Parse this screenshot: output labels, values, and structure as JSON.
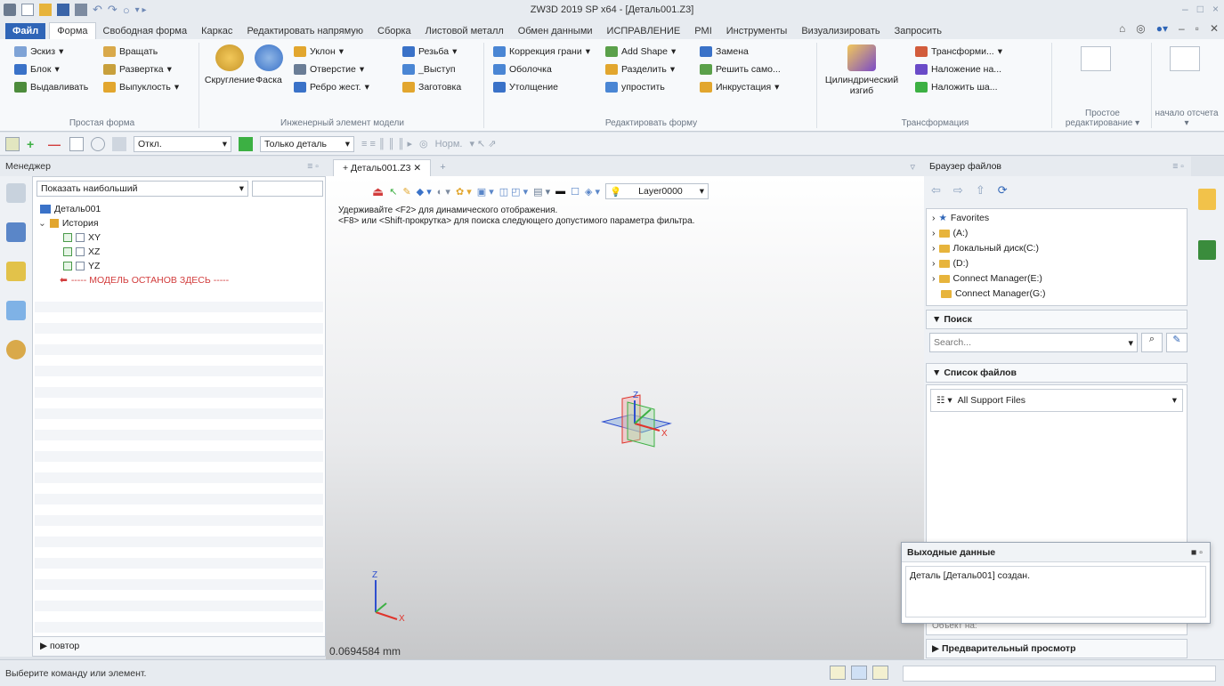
{
  "window": {
    "title": "ZW3D 2019 SP x64 - [Деталь001.Z3]",
    "controls": [
      "–",
      "□",
      "×"
    ]
  },
  "ribbon_tabs": [
    "Файл",
    "Форма",
    "Свободная форма",
    "Каркас",
    "Редактировать напрямую",
    "Сборка",
    "Листовой металл",
    "Обмен данными",
    "ИСПРАВЛЕНИЕ",
    "PMI",
    "Инструменты",
    "Визуализировать",
    "Запросить"
  ],
  "ribbon": {
    "simple_form": {
      "label": "Простая форма",
      "items": [
        "Эскиз",
        "Вращать",
        "Блок",
        "Развертка",
        "Выдавливать",
        "Выпуклость"
      ]
    },
    "engineering": {
      "label": "Инженерный элемент модели",
      "big1": "Скругление",
      "big2": "Фаска",
      "items": [
        "Уклон",
        "Резьба",
        "Отверстие",
        "_Выступ",
        "Ребро жест.",
        "Заготовка"
      ]
    },
    "edit_form": {
      "label": "Редактировать форму",
      "items": [
        "Коррекция грани",
        "Add Shape",
        "Замена",
        "Оболочка",
        "Разделить",
        "Решить само...",
        "Утолщение",
        "упростить",
        "Инкрустация"
      ]
    },
    "transform": {
      "label": "Трансформация",
      "big": "Цилиндрический изгиб",
      "items": [
        "Трансформи...",
        "Наложение на...",
        "Наложить ша..."
      ]
    },
    "simple_edit": {
      "label": "Простое редактирование"
    },
    "origin": {
      "label": "начало отсчета"
    }
  },
  "toolbar": {
    "filter_off": "Откл.",
    "filter_part": "Только деталь",
    "norm": "Норм."
  },
  "manager": {
    "title": "Менеджер",
    "filter": "Показать наибольший",
    "tree": {
      "root": "Деталь001",
      "history": "История",
      "planes": [
        "XY",
        "XZ",
        "YZ"
      ],
      "stop": "----- МОДЕЛЬ ОСТАНОВ ЗДЕСЬ -----"
    },
    "footer": "повтор"
  },
  "viewport": {
    "tab": "+ Деталь001.Z3",
    "layer": "Layer0000",
    "hint1": "Удерживайте <F2> для динамического отображения.",
    "hint2": "<F8> или <Shift-прокрутка> для поиска следующего допустимого параметра фильтра.",
    "scale": "0.0694584 mm",
    "axes": {
      "x": "X",
      "y": "Y",
      "z": "Z"
    }
  },
  "file_browser": {
    "title": "Браузер файлов",
    "items": [
      "Favorites",
      "(A:)",
      "Локальный диск(C:)",
      "(D:)",
      "Connect Manager(E:)",
      "Connect Manager(G:)"
    ],
    "search_section": "Поиск",
    "search_placeholder": "Search...",
    "file_list_section": "Список файлов",
    "file_type": "All Support Files",
    "obscured_label": "Объект на:",
    "preview_section": "Предварительный просмотр"
  },
  "output": {
    "title": "Выходные данные",
    "message": "Деталь [Деталь001] создан."
  },
  "status": {
    "message": "Выберите команду или элемент."
  },
  "colors": {
    "accent": "#2f65b7",
    "folder": "#e7b43c",
    "stop_red": "#d23c3c",
    "axis_x": "#e0342c",
    "axis_y": "#3cb043",
    "axis_z": "#2f4fcf"
  }
}
